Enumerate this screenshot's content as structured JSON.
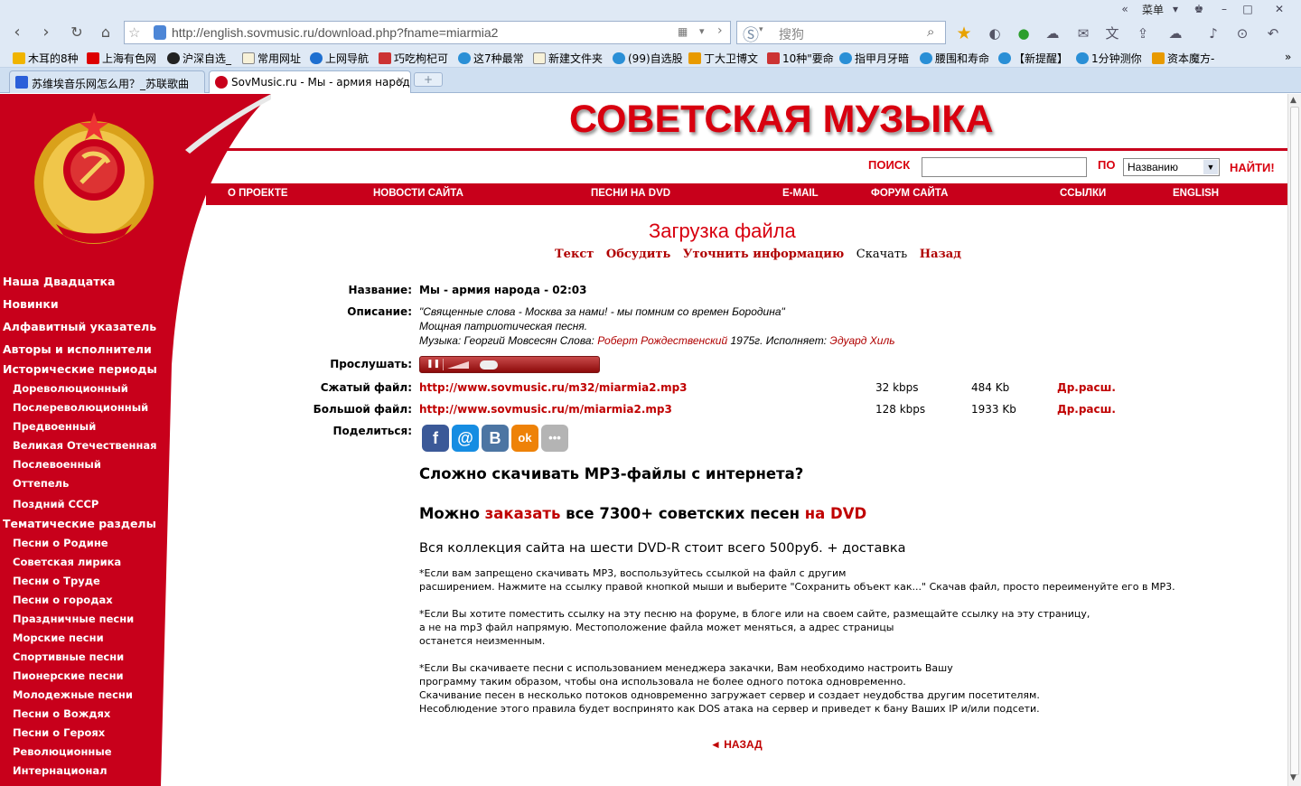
{
  "browser": {
    "menu_label": "菜单",
    "url": "http://english.sovmusic.ru/download.php?fname=miarmia2",
    "search_placeholder": "搜狗",
    "bookmarks": [
      "木耳的8种",
      "上海有色网",
      "沪深自选_",
      "常用网址",
      "上网导航",
      "巧吃枸杞可",
      "这7种最常",
      "新建文件夹",
      "(99)自选股",
      "丁大卫博文",
      "10种\"要命",
      "指甲月牙暗",
      "腰围和寿命",
      "【新提醒】",
      "1分钟测你",
      "资本魔方-"
    ],
    "tabs": [
      {
        "title": "苏维埃音乐网怎么用？_苏联歌曲"
      },
      {
        "title": "SovMusic.ru - Мы - армия народа"
      }
    ]
  },
  "site": {
    "title": "СОВЕТСКАЯ МУЗЫКА",
    "search_label": "ПОИСК",
    "by_label": "ПО",
    "select_value": "Названию",
    "find_button": "НАЙТИ!",
    "topnav": [
      "О ПРОЕКТЕ",
      "НОВОСТИ САЙТА",
      "ПЕСНИ НА DVD",
      "E-MAIL",
      "ФОРУМ САЙТА",
      "ССЫЛКИ",
      "ENGLISH"
    ]
  },
  "sidebar": {
    "items": [
      {
        "label": "Наша Двадцатка",
        "level": "top"
      },
      {
        "label": "Новинки",
        "level": "top"
      },
      {
        "label": "Алфавитный указатель",
        "level": "top"
      },
      {
        "label": "Авторы и исполнители",
        "level": "top"
      },
      {
        "label": "Исторические периоды",
        "level": "top"
      },
      {
        "label": "Дореволюционный",
        "level": "sub"
      },
      {
        "label": "Послереволюционный",
        "level": "sub"
      },
      {
        "label": "Предвоенный",
        "level": "sub"
      },
      {
        "label": "Великая Отечественная",
        "level": "sub"
      },
      {
        "label": "Послевоенный",
        "level": "sub"
      },
      {
        "label": "Оттепель",
        "level": "sub"
      },
      {
        "label": "Поздний СССР",
        "level": "sub"
      },
      {
        "label": "Тематические разделы",
        "level": "top"
      },
      {
        "label": "Песни о Родине",
        "level": "sub"
      },
      {
        "label": "Советская лирика",
        "level": "sub"
      },
      {
        "label": "Песни о Труде",
        "level": "sub"
      },
      {
        "label": "Песни о городах",
        "level": "sub"
      },
      {
        "label": "Праздничные песни",
        "level": "sub"
      },
      {
        "label": "Морские песни",
        "level": "sub"
      },
      {
        "label": "Спортивные песни",
        "level": "sub"
      },
      {
        "label": "Пионерские песни",
        "level": "sub"
      },
      {
        "label": "Молодежные песни",
        "level": "sub"
      },
      {
        "label": "Песни о Вождях",
        "level": "sub"
      },
      {
        "label": "Песни о Героях",
        "level": "sub"
      },
      {
        "label": "Революционные",
        "level": "sub"
      },
      {
        "label": "Интернационал",
        "level": "sub"
      }
    ]
  },
  "main": {
    "heading": "Загрузка файла",
    "subnav": {
      "text": "Текст",
      "discuss": "Обсудить",
      "refine": "Уточнить информацию",
      "download": "Скачать",
      "back": "Назад"
    },
    "labels": {
      "name": "Название:",
      "description": "Описание:",
      "listen": "Прослушать:",
      "compressed": "Сжатый файл:",
      "large": "Большой файл:",
      "share": "Поделиться:"
    },
    "name_value": "Мы - армия народа - 02:03",
    "desc_line1": "\"Священные слова - Москва за нами! - мы помним со времен Бородина\"",
    "desc_line2": "Мощная патриотическая песня.",
    "desc_music_prefix": "Музыка: Георгий Мовсесян Слова: ",
    "desc_lyricist": "Роберт Рождественский",
    "desc_year": " 1975г. Исполняет: ",
    "desc_performer": "Эдуард Хиль",
    "files": [
      {
        "url": "http://www.sovmusic.ru/m32/miarmia2.mp3",
        "bitrate": "32 kbps",
        "size": "484 Kb",
        "ext": "Др.расш."
      },
      {
        "url": "http://www.sovmusic.ru/m/miarmia2.mp3",
        "bitrate": "128 kbps",
        "size": "1933 Kb",
        "ext": "Др.расш."
      }
    ],
    "share_icons": [
      {
        "name": "facebook-icon",
        "glyph": "f",
        "color": "#3b5998"
      },
      {
        "name": "mailru-icon",
        "glyph": "@",
        "color": "#168de2"
      },
      {
        "name": "vk-icon",
        "glyph": "B",
        "color": "#4c75a3"
      },
      {
        "name": "odnoklassniki-icon",
        "glyph": "ok",
        "color": "#ee8208"
      },
      {
        "name": "more-share-icon",
        "glyph": "•••",
        "color": "#b4b4b4"
      }
    ],
    "promo_q": "Сложно скачивать MP3-файлы с интернета?",
    "promo_prefix": "Можно ",
    "promo_order": "заказать",
    "promo_mid": " все 7300+ советских песен ",
    "promo_dvd": "на DVD",
    "dvd_line": "Вся коллекция сайта на шести DVD-R стоит всего 500руб. + доставка",
    "notes": [
      "*Если вам запрещено скачивать MP3, воспользуйтесь ссылкой на файл с другим",
      "расширением. Нажмите на ссылку правой кнопкой мыши и выберите \"Сохранить объект как...\" Скачав файл, просто переименуйте его в MP3.",
      "*Если Вы хотите поместить ссылку на эту песню на форуме, в блоге или на своем сайте, размещайте ссылку на эту страницу,",
      "а не на mp3 файл напрямую. Местоположение файла может меняться, а адрес страницы",
      "останется неизменным.",
      "*Если Вы скачиваете песни с использованием менеджера закачки, Вам необходимо настроить Вашу",
      "программу таким образом, чтобы она использовала не более одного потока одновременно.",
      "Скачивание песен в несколько потоков одновременно загружает сервер и создает неудобства другим посетителям.",
      "Несоблюдение этого правила будет воспринято как DOS атака на сервер и приведет к бану Ваших IP и/или подсети."
    ],
    "back_link": "◄ НАЗАД"
  }
}
